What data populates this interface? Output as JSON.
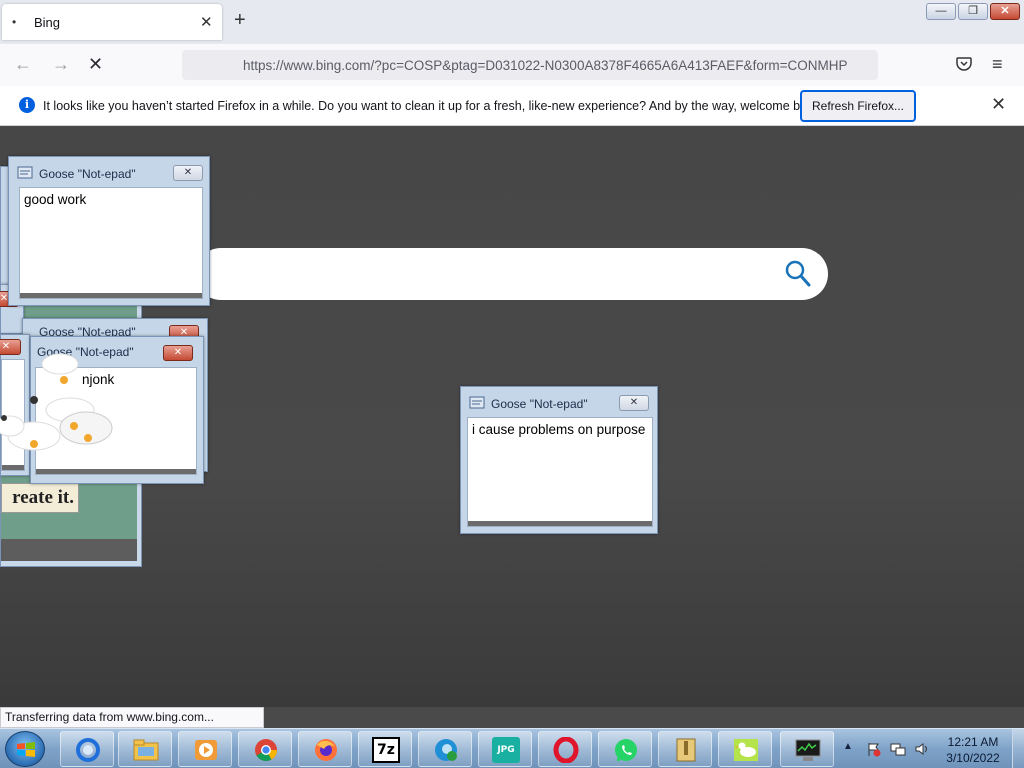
{
  "browser": {
    "tab_title": "Bing",
    "tab_dot": "•",
    "tab_close": "✕",
    "new_tab": "+",
    "url": "https://www.bing.com/?pc=COSP&ptag=D031022-N0300A8378F4665A6A413FAEF&form=CONMHP",
    "window_buttons": {
      "minimize": "—",
      "maximize": "❐",
      "close": "✕"
    },
    "nav": {
      "back": "←",
      "forward": "→",
      "stop": "✕",
      "menu": "≡"
    }
  },
  "notification": {
    "message": "It looks like you haven’t started Firefox in a while. Do you want to clean it up for a fresh, like-new experience? And by the way, welcome back!",
    "button": "Refresh Firefox...",
    "close": "✕",
    "info": "i"
  },
  "goose_windows": [
    {
      "title": "Goose \"Not-epad\"",
      "text": "good work"
    },
    {
      "title": "Goose \"Not-epad\"",
      "text": ""
    },
    {
      "title": "Goose \"Not-epad\"",
      "text": "njonk"
    },
    {
      "title": "Goose \"Not-epad\"",
      "text": "i cause problems on purpose"
    }
  ],
  "goose_close": "✕",
  "poster_text": "reate it.",
  "status_bar": "Transferring data from www.bing.com...",
  "taskbar": {
    "apps": [
      "IE",
      "Explorer",
      "Media",
      "Chrome",
      "Firefox",
      "7z",
      "Edge",
      "JPG",
      "Opera",
      "WhatsApp",
      "Archive",
      "Goose",
      "Monitor"
    ],
    "seven_zip_label": "7z",
    "jpg_label": "JPG",
    "tray_up": "▲",
    "clock_time": "12:21 AM",
    "clock_date": "3/10/2022"
  }
}
